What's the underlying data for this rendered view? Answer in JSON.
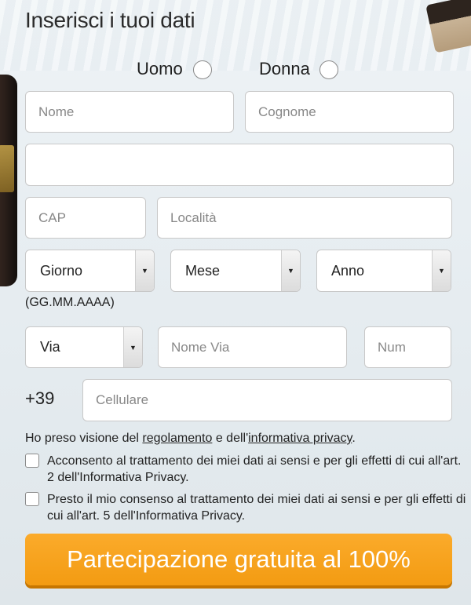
{
  "title": "Inserisci i tuoi dati",
  "gender": {
    "male_label": "Uomo",
    "female_label": "Donna"
  },
  "fields": {
    "nome_placeholder": "Nome",
    "cognome_placeholder": "Cognome",
    "address_value": "",
    "cap_placeholder": "CAP",
    "localita_placeholder": "Località",
    "via_placeholder": "Nome Via",
    "num_placeholder": "Num",
    "cellulare_placeholder": "Cellulare"
  },
  "selects": {
    "giorno": "Giorno",
    "mese": "Mese",
    "anno": "Anno",
    "via_type": "Via"
  },
  "date_hint": "(GG.MM.AAAA)",
  "phone_prefix": "+39",
  "privacy": {
    "prefix": "Ho preso visione del ",
    "regolamento_link": "regolamento",
    "middle": " e dell'",
    "informativa_link": "informativa privacy",
    "suffix": "."
  },
  "consents": [
    {
      "text": "Acconsento al trattamento dei miei dati ai sensi e per gli effetti di cui all'art. 2 dell'Informativa Privacy."
    },
    {
      "text": "Presto il mio consenso al trattamento dei miei dati ai sensi e per gli effetti di cui all'art. 5 dell'Informativa Privacy."
    }
  ],
  "cta_label": "Partecipazione gratuita al 100%",
  "colors": {
    "cta": "#f7a11c",
    "cta_shadow": "#c77600"
  }
}
